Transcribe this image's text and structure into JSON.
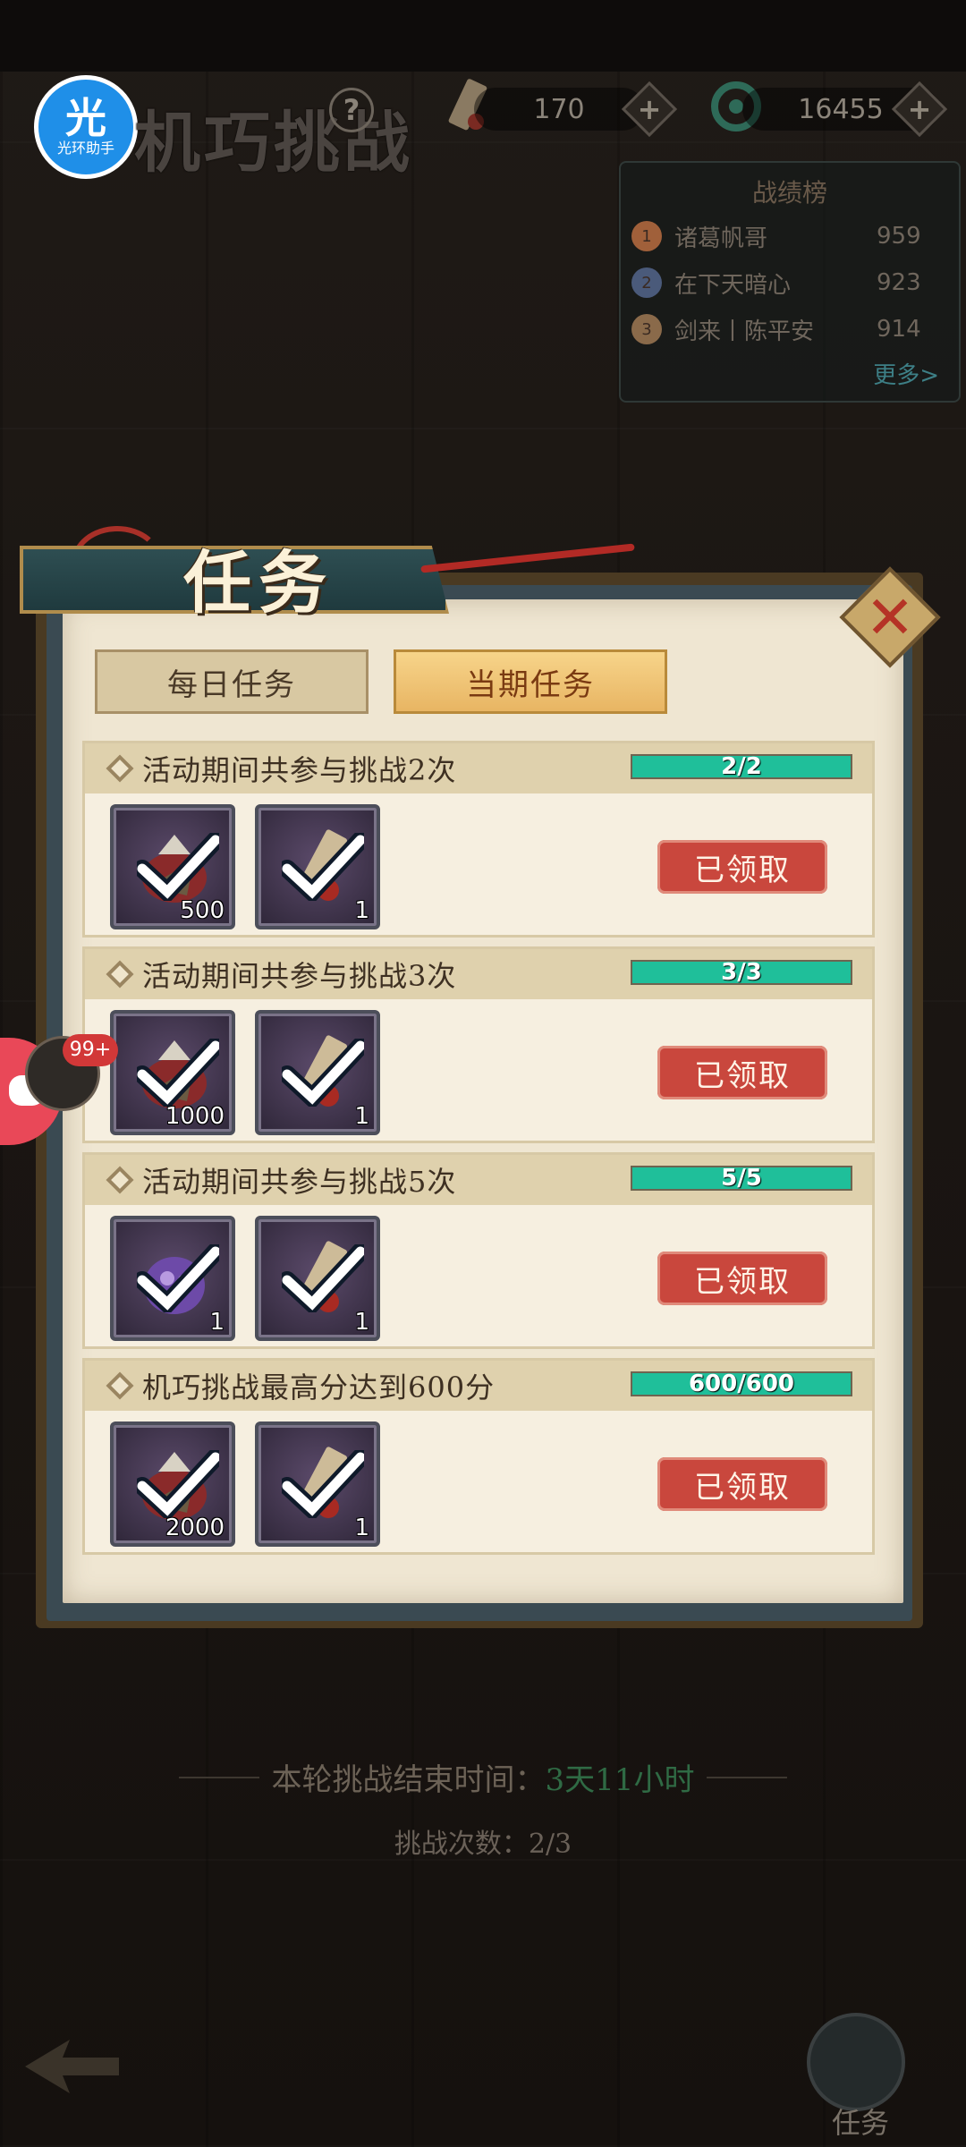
{
  "hud": {
    "logo_char": "光",
    "logo_text": "光环助手",
    "title": "机巧挑战",
    "help": "?",
    "resource1_value": "170",
    "resource2_value": "16455",
    "plus": "+"
  },
  "leaderboard": {
    "title": "战绩榜",
    "entries": [
      {
        "rank": "1",
        "name": "诸葛帆哥",
        "score": "959"
      },
      {
        "rank": "2",
        "name": "在下天暗心",
        "score": "923"
      },
      {
        "rank": "3",
        "name": "剑来丨陈平安",
        "score": "914"
      }
    ],
    "more": "更多>"
  },
  "panel": {
    "title": "任务",
    "close": "✕",
    "tabs": [
      {
        "label": "每日任务",
        "active": false
      },
      {
        "label": "当期任务",
        "active": true
      }
    ]
  },
  "tasks": [
    {
      "title": "活动期间共参与挑战2次",
      "progress_text": "2/2",
      "progress": 1.0,
      "rewards": [
        {
          "icon": "copper-coin-pouch",
          "qty": "500"
        },
        {
          "icon": "challenge-token-scroll",
          "qty": "1"
        }
      ],
      "status": "已领取"
    },
    {
      "title": "活动期间共参与挑战3次",
      "progress_text": "3/3",
      "progress": 1.0,
      "rewards": [
        {
          "icon": "copper-coin-pouch",
          "qty": "1000"
        },
        {
          "icon": "challenge-token-scroll",
          "qty": "1"
        }
      ],
      "status": "已领取"
    },
    {
      "title": "活动期间共参与挑战5次",
      "progress_text": "5/5",
      "progress": 1.0,
      "rewards": [
        {
          "icon": "purple-spirit-pouch",
          "qty": "1"
        },
        {
          "icon": "challenge-token-scroll",
          "qty": "1"
        }
      ],
      "status": "已领取"
    },
    {
      "title": "机巧挑战最高分达到600分",
      "progress_text": "600/600",
      "progress": 1.0,
      "rewards": [
        {
          "icon": "copper-coin-pouch",
          "qty": "2000"
        },
        {
          "icon": "challenge-token-scroll",
          "qty": "1"
        }
      ],
      "status": "已领取"
    }
  ],
  "footer": {
    "end_time_label": "本轮挑战结束时间：",
    "end_time_value": "3天11小时",
    "challenge_count": "挑战次数：2/3",
    "task_button_label": "任务"
  },
  "float": {
    "badge": "99+"
  },
  "colors": {
    "progress_fill": "#1fbf9a",
    "claimed_button": "#c9473d",
    "active_tab": "#f0c474",
    "panel_paper": "#efe6d2",
    "time_green": "#2f6a44"
  }
}
